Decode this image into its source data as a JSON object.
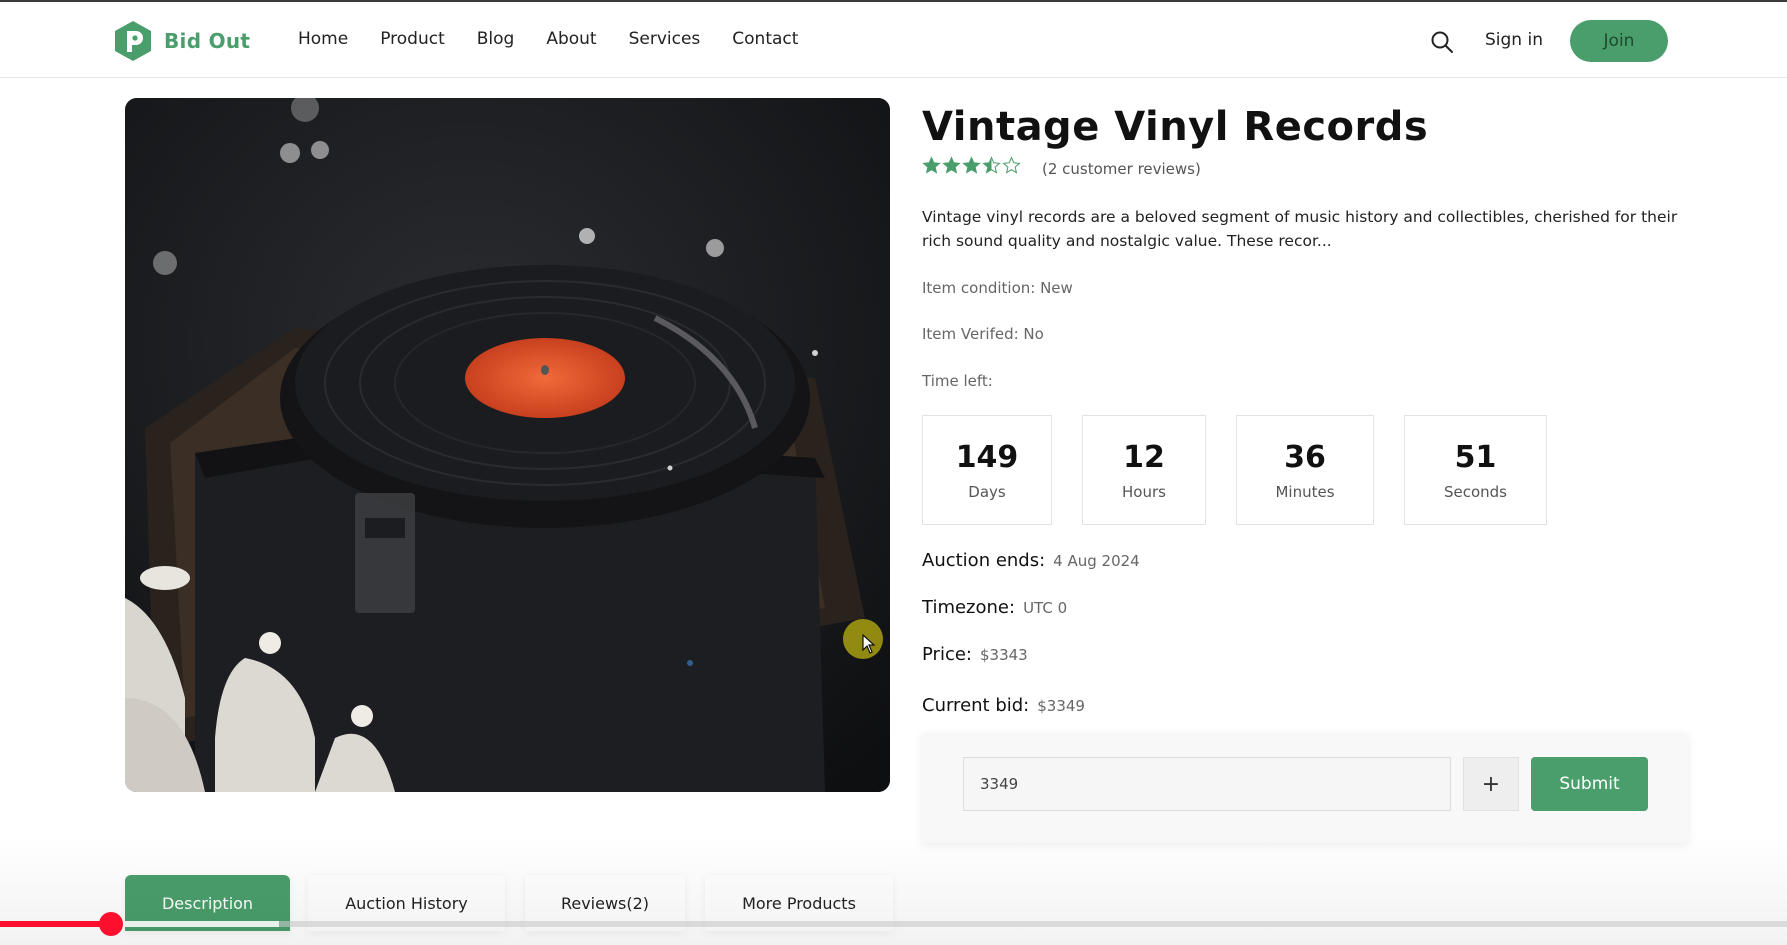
{
  "brand": {
    "name": "Bid Out",
    "accent": "#4a9e6b"
  },
  "nav": {
    "items": [
      "Home",
      "Product",
      "Blog",
      "About",
      "Services",
      "Contact"
    ]
  },
  "header": {
    "signin_label": "Sign in",
    "join_label": "Join"
  },
  "product": {
    "title": "Vintage Vinyl Records",
    "rating": 3.5,
    "rating_max": 5,
    "reviews_text": "(2 customer reviews)",
    "description": "Vintage vinyl records are a beloved segment of music history and collectibles, cherished for their rich sound quality and nostalgic value. These recor...",
    "condition": "Item condition: New",
    "verified": "Item Verifed: No",
    "time_left_label": "Time left:"
  },
  "countdown": [
    {
      "value": "149",
      "label": "Days"
    },
    {
      "value": "12",
      "label": "Hours"
    },
    {
      "value": "36",
      "label": "Minutes"
    },
    {
      "value": "51",
      "label": "Seconds"
    }
  ],
  "details": {
    "auction_ends_label": "Auction ends:",
    "auction_ends_value": "4 Aug 2024",
    "timezone_label": "Timezone:",
    "timezone_value": "UTC 0",
    "price_label": "Price:",
    "price_value": "$3343",
    "current_bid_label": "Current bid:",
    "current_bid_value": "$3349"
  },
  "bid_form": {
    "value": "3349",
    "plus_label": "+",
    "submit_label": "Submit"
  },
  "tabs": [
    {
      "label": "Description",
      "active": true
    },
    {
      "label": "Auction History",
      "active": false
    },
    {
      "label": "Reviews(2)",
      "active": false
    },
    {
      "label": "More Products",
      "active": false
    }
  ],
  "video_progress": {
    "played_fraction": 0.062,
    "buffered_fraction": 0.156
  }
}
